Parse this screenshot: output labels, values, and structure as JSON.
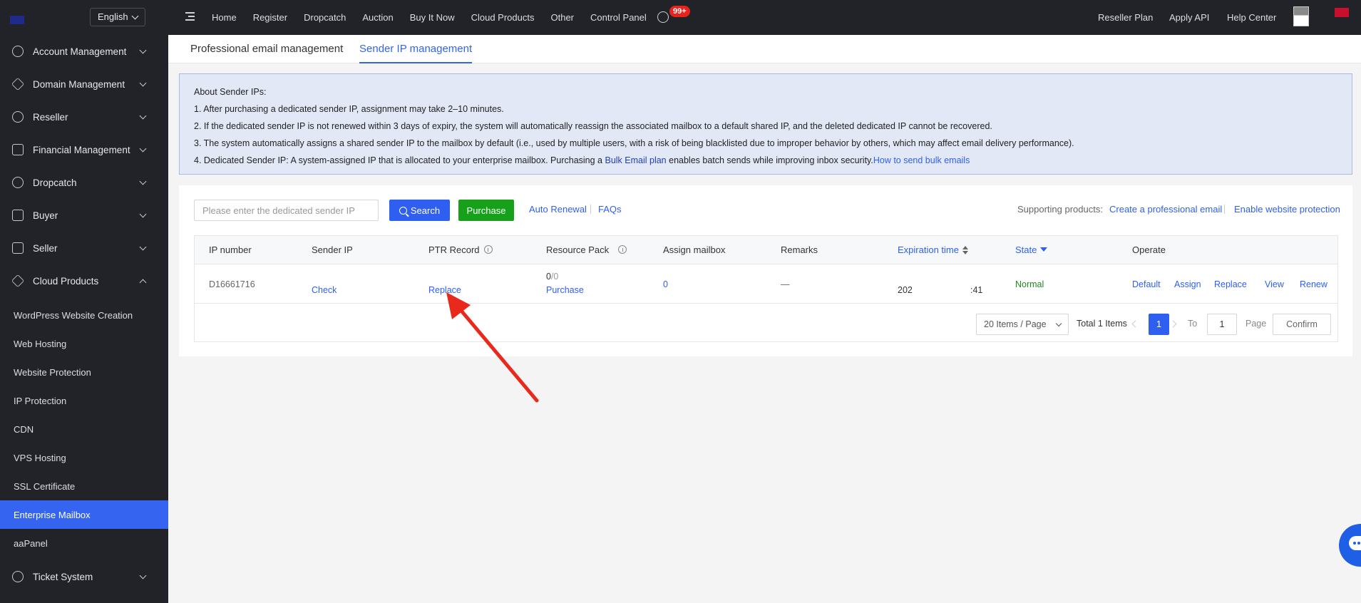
{
  "topbar": {
    "language": "English",
    "nav": [
      "Home",
      "Register",
      "Dropcatch",
      "Auction",
      "Buy It Now",
      "Cloud Products",
      "Other",
      "Control Panel"
    ],
    "message_badge": "99+",
    "right": [
      "Reseller Plan",
      "Apply API",
      "Help Center"
    ]
  },
  "sidebar": {
    "groups": [
      {
        "label": "Account Management",
        "icon": "user-icon"
      },
      {
        "label": "Domain Management",
        "icon": "layers-icon"
      },
      {
        "label": "Reseller",
        "icon": "reseller-icon"
      },
      {
        "label": "Financial Management",
        "icon": "finance-icon"
      },
      {
        "label": "Dropcatch",
        "icon": "clock-icon"
      },
      {
        "label": "Buyer",
        "icon": "cart-icon"
      },
      {
        "label": "Seller",
        "icon": "store-icon"
      },
      {
        "label": "Cloud Products",
        "icon": "cloud-icon",
        "expanded": true
      }
    ],
    "sub_items": [
      "WordPress Website Creation",
      "Web Hosting",
      "Website Protection",
      "IP Protection",
      "CDN",
      "VPS Hosting",
      "SSL Certificate",
      "Enterprise Mailbox",
      "aaPanel"
    ],
    "active_item": "Enterprise Mailbox",
    "footer_group": {
      "label": "Ticket System",
      "icon": "ticket-icon"
    }
  },
  "tabs": [
    "Professional email management",
    "Sender IP management"
  ],
  "active_tab": "Sender IP management",
  "notice": {
    "title": "About Sender IPs:",
    "line1": "1. After purchasing a dedicated sender IP, assignment may take 2–10 minutes.",
    "line2": "2. If the dedicated sender IP is not renewed within 3 days of expiry, the system will automatically reassign the associated mailbox to a default shared IP, and the deleted dedicated IP cannot be recovered.",
    "line3": "3. The system automatically assigns a shared sender IP to the mailbox by default (i.e., used by multiple users, with a risk of being blacklisted due to improper behavior by others, which may affect email delivery performance).",
    "line4_prefix": "4. Dedicated Sender IP: A system-assigned IP that is allocated to your enterprise mailbox. Purchasing a ",
    "line4_link1": "Bulk Email plan",
    "line4_middle": " enables batch sends while improving inbox security.",
    "line4_link2": "How to send bulk emails"
  },
  "toolbar": {
    "search_placeholder": "Please enter the dedicated sender IP",
    "search_label": "Search",
    "purchase_label": "Purchase",
    "auto_renewal": "Auto Renewal",
    "faqs": "FAQs",
    "supporting_label": "Supporting products:",
    "create_email": "Create a professional email",
    "enable_protection": "Enable website protection"
  },
  "table": {
    "headers": [
      "IP number",
      "Sender IP",
      "PTR Record",
      "Resource Pack",
      "Assign mailbox",
      "Remarks",
      "Expiration time",
      "State",
      "Operate"
    ],
    "row": {
      "ip_number": "D16661716",
      "sender_ip": "Check",
      "ptr_record": "Replace",
      "resource_used": "0",
      "resource_total": "/0",
      "resource_purchase": "Purchase",
      "assign_mailbox": "0",
      "remarks": "—",
      "expiration_fragment_start": "202",
      "expiration_fragment_end": ":41",
      "state": "Normal",
      "operations": [
        "Default",
        "Assign",
        "Replace",
        "View",
        "Renew"
      ]
    }
  },
  "pagination": {
    "page_size": "20 Items / Page",
    "total": "Total 1 Items",
    "current": "1",
    "to_label": "To",
    "jump_value": "1",
    "page_label": "Page",
    "confirm_label": "Confirm"
  },
  "colors": {
    "accent": "#2f5ff0",
    "sidebar_bg": "#212329",
    "purchase_green": "#17a01a",
    "annotation_arrow": "#e8291c"
  }
}
